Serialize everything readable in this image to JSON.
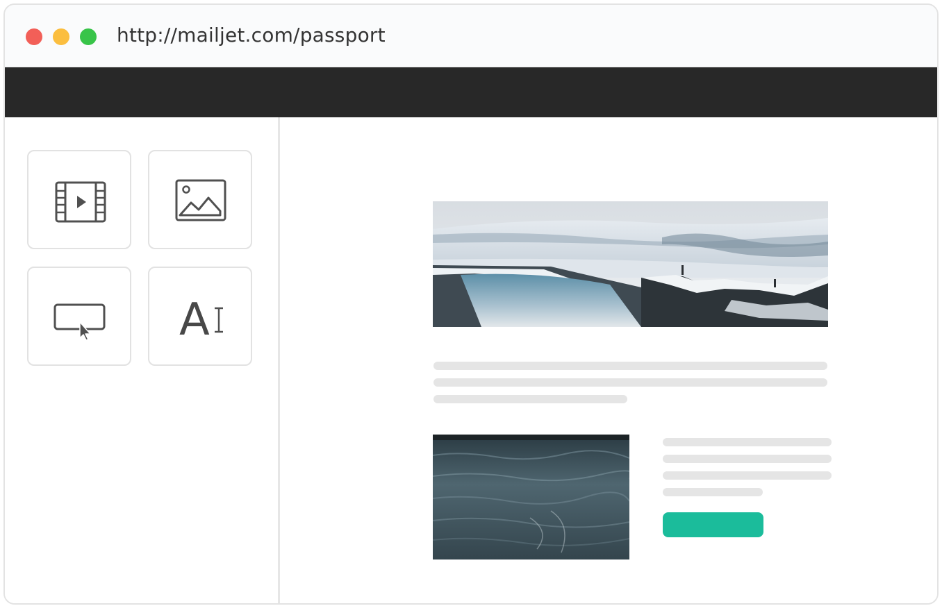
{
  "window": {
    "url": "http://mailjet.com/passport",
    "controls": [
      {
        "name": "close",
        "color": "#f25f58"
      },
      {
        "name": "minimize",
        "color": "#fbbe3f"
      },
      {
        "name": "maximize",
        "color": "#38c449"
      }
    ]
  },
  "toolbar": {
    "color": "#282828"
  },
  "sidebar": {
    "tools": [
      {
        "name": "video-block",
        "icon": "film-icon"
      },
      {
        "name": "image-block",
        "icon": "image-icon"
      },
      {
        "name": "button-block",
        "icon": "button-cursor-icon"
      },
      {
        "name": "text-block",
        "icon": "text-icon",
        "glyph": "A"
      }
    ]
  },
  "email": {
    "hero_image": "frozen waterfall landscape",
    "inline_image": "dark water surface",
    "cta_button": {
      "label": "",
      "color": "#1bbc9b"
    }
  }
}
